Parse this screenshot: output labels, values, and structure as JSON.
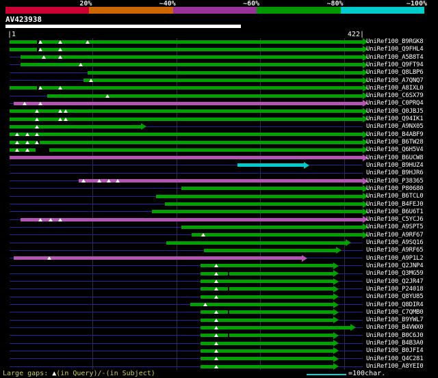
{
  "chart_data": {
    "type": "bar",
    "subtype": "blast-alignment-overview",
    "query_id": "AV423938",
    "identity_scale": {
      "labels": [
        "20%",
        "~40%",
        "~60%",
        "~80%",
        "~100%"
      ],
      "colors": [
        "#cc0033",
        "#cc6600",
        "#993399",
        "#009900",
        "#00cccc"
      ]
    },
    "axis": {
      "start_label": "|1",
      "end_label": "422|",
      "min": 1,
      "max": 422,
      "units": "chars"
    },
    "bar_colors": {
      "green": "#00a000",
      "magenta": "#b455b4",
      "cyan": "#00cccc"
    },
    "rows": [
      {
        "label": "UniRef100_B9RGK8",
        "color": "green",
        "start": 1,
        "end": 422,
        "gaps_query": [
          38,
          61,
          94
        ],
        "gaps_subject": [
          {
            "c": 35,
            "w": 3
          }
        ]
      },
      {
        "label": "UniRef100_Q9FHL4",
        "color": "green",
        "start": 1,
        "end": 422,
        "gaps_query": [
          38,
          61
        ],
        "gaps_subject": [
          {
            "c": 35,
            "w": 3
          }
        ]
      },
      {
        "label": "UniRef100_A5B8T4",
        "color": "green",
        "start": 14,
        "end": 422,
        "gaps_query": [
          42,
          61
        ],
        "gaps_subject": []
      },
      {
        "label": "UniRef100_Q9FT94",
        "color": "green",
        "start": 14,
        "end": 422,
        "gaps_query": [
          86
        ],
        "gaps_subject": []
      },
      {
        "label": "UniRef100_Q8LBP6",
        "color": "green",
        "start": 94,
        "end": 422,
        "gaps_query": [],
        "gaps_subject": []
      },
      {
        "label": "UniRef100_A7QNQ7",
        "color": "green",
        "start": 89,
        "end": 422,
        "gaps_query": [
          98
        ],
        "gaps_subject": []
      },
      {
        "label": "UniRef100_A8IXL0",
        "color": "green",
        "start": 1,
        "end": 422,
        "gaps_query": [
          38,
          61
        ],
        "gaps_subject": [
          {
            "c": 35,
            "w": 3
          }
        ]
      },
      {
        "label": "UniRef100_C6SX79",
        "color": "green",
        "start": 46,
        "end": 422,
        "gaps_query": [
          118
        ],
        "gaps_subject": []
      },
      {
        "label": "UniRef100_C0PRQ4",
        "color": "magenta",
        "start": 6,
        "end": 422,
        "gaps_query": [
          19,
          38
        ],
        "gaps_subject": []
      },
      {
        "label": "UniRef100_Q0JBJ5",
        "color": "green",
        "start": 1,
        "end": 422,
        "gaps_query": [
          34,
          61,
          68
        ],
        "gaps_subject": []
      },
      {
        "label": "UniRef100_Q94IK1",
        "color": "green",
        "start": 1,
        "end": 422,
        "gaps_query": [
          34,
          61,
          68
        ],
        "gaps_subject": []
      },
      {
        "label": "UniRef100_A9NX05",
        "color": "green",
        "start": 1,
        "end": 158,
        "gaps_query": [
          34
        ],
        "gaps_subject": []
      },
      {
        "label": "UniRef100_B4ABF9",
        "color": "green",
        "start": 1,
        "end": 422,
        "gaps_query": [
          10,
          22,
          34
        ],
        "gaps_subject": []
      },
      {
        "label": "UniRef100_B6TW28",
        "color": "green",
        "start": 1,
        "end": 422,
        "gaps_query": [
          10,
          22,
          34
        ],
        "gaps_subject": [
          {
            "c": 36,
            "w": 3
          }
        ]
      },
      {
        "label": "UniRef100_Q6H5V4",
        "color": "green",
        "start": 1,
        "end": 422,
        "gaps_query": [
          10,
          22
        ],
        "gaps_subject": [
          {
            "c": 40,
            "w": 20
          }
        ]
      },
      {
        "label": "UniRef100_B6UCW8",
        "color": "magenta",
        "start": 1,
        "end": 422,
        "gaps_query": [],
        "gaps_subject": []
      },
      {
        "label": "UniRef100_B9HUZ4",
        "color": "cyan",
        "start": 273,
        "end": 352,
        "gaps_query": [],
        "gaps_subject": []
      },
      {
        "label": "UniRef100_B9HJR6",
        "color": null,
        "start": null,
        "end": null,
        "gaps_query": [],
        "gaps_subject": []
      },
      {
        "label": "UniRef100_P38365",
        "color": "magenta",
        "start": 83,
        "end": 422,
        "gaps_query": [
          89,
          108,
          119,
          130
        ],
        "gaps_subject": []
      },
      {
        "label": "UniRef100_P80680",
        "color": "green",
        "start": 206,
        "end": 422,
        "gaps_query": [],
        "gaps_subject": []
      },
      {
        "label": "UniRef100_B6TCL0",
        "color": "green",
        "start": 176,
        "end": 422,
        "gaps_query": [],
        "gaps_subject": []
      },
      {
        "label": "UniRef100_B4FEJ0",
        "color": "green",
        "start": 186,
        "end": 422,
        "gaps_query": [],
        "gaps_subject": []
      },
      {
        "label": "UniRef100_B6U6T1",
        "color": "green",
        "start": 171,
        "end": 422,
        "gaps_query": [],
        "gaps_subject": []
      },
      {
        "label": "UniRef100_C5YCJ6",
        "color": "magenta",
        "start": 14,
        "end": 422,
        "gaps_query": [
          38,
          50,
          61
        ],
        "gaps_subject": []
      },
      {
        "label": "UniRef100_A9SPT5",
        "color": "green",
        "start": 206,
        "end": 422,
        "gaps_query": [],
        "gaps_subject": []
      },
      {
        "label": "UniRef100_A9RF67",
        "color": "green",
        "start": 218,
        "end": 422,
        "gaps_query": [
          232
        ],
        "gaps_subject": []
      },
      {
        "label": "UniRef100_A9SQ16",
        "color": "green",
        "start": 188,
        "end": 402,
        "gaps_query": [],
        "gaps_subject": []
      },
      {
        "label": "UniRef100_A9RF65",
        "color": "green",
        "start": 233,
        "end": 390,
        "gaps_query": [],
        "gaps_subject": []
      },
      {
        "label": "UniRef100_A9P1L2",
        "color": "magenta",
        "start": 6,
        "end": 349,
        "gaps_query": [
          48
        ],
        "gaps_subject": []
      },
      {
        "label": "UniRef100_Q2JNP4",
        "color": "green",
        "start": 229,
        "end": 387,
        "gaps_query": [
          247
        ],
        "gaps_subject": []
      },
      {
        "label": "UniRef100_Q3MG59",
        "color": "green",
        "start": 229,
        "end": 387,
        "gaps_query": [
          247
        ],
        "gaps_subject": [
          {
            "c": 262,
            "w": 2
          }
        ]
      },
      {
        "label": "UniRef100_Q2JR47",
        "color": "green",
        "start": 229,
        "end": 387,
        "gaps_query": [
          247
        ],
        "gaps_subject": []
      },
      {
        "label": "UniRef100_P24018",
        "color": "green",
        "start": 229,
        "end": 387,
        "gaps_query": [
          247
        ],
        "gaps_subject": [
          {
            "c": 262,
            "w": 2
          }
        ]
      },
      {
        "label": "UniRef100_Q8YU85",
        "color": "green",
        "start": 229,
        "end": 387,
        "gaps_query": [
          247
        ],
        "gaps_subject": []
      },
      {
        "label": "UniRef100_Q8DIR4",
        "color": "green",
        "start": 216,
        "end": 387,
        "gaps_query": [
          234
        ],
        "gaps_subject": []
      },
      {
        "label": "UniRef100_C7QMB0",
        "color": "green",
        "start": 229,
        "end": 387,
        "gaps_query": [
          247
        ],
        "gaps_subject": [
          {
            "c": 262,
            "w": 2
          }
        ]
      },
      {
        "label": "UniRef100_B9YWL7",
        "color": "green",
        "start": 229,
        "end": 387,
        "gaps_query": [
          247
        ],
        "gaps_subject": []
      },
      {
        "label": "UniRef100_B4VWX0",
        "color": "green",
        "start": 229,
        "end": 407,
        "gaps_query": [
          247
        ],
        "gaps_subject": []
      },
      {
        "label": "UniRef100_B0C6J0",
        "color": "green",
        "start": 229,
        "end": 387,
        "gaps_query": [
          247
        ],
        "gaps_subject": [
          {
            "c": 262,
            "w": 2
          }
        ]
      },
      {
        "label": "UniRef100_B4B3A0",
        "color": "green",
        "start": 229,
        "end": 387,
        "gaps_query": [
          247
        ],
        "gaps_subject": []
      },
      {
        "label": "UniRef100_B0JFI4",
        "color": "green",
        "start": 229,
        "end": 387,
        "gaps_query": [
          247
        ],
        "gaps_subject": []
      },
      {
        "label": "UniRef100_Q4C281",
        "color": "green",
        "start": 229,
        "end": 387,
        "gaps_query": [
          247
        ],
        "gaps_subject": []
      },
      {
        "label": "UniRef100_A8YEI0",
        "color": "green",
        "start": 229,
        "end": 387,
        "gaps_query": [
          247
        ],
        "gaps_subject": []
      }
    ],
    "legend": {
      "gaps_prefix": "Large gaps: ",
      "gaps_triangle": "▲",
      "gaps_suffix": "(in Query)/-(in Subject)",
      "scale_label": "=100char."
    }
  }
}
